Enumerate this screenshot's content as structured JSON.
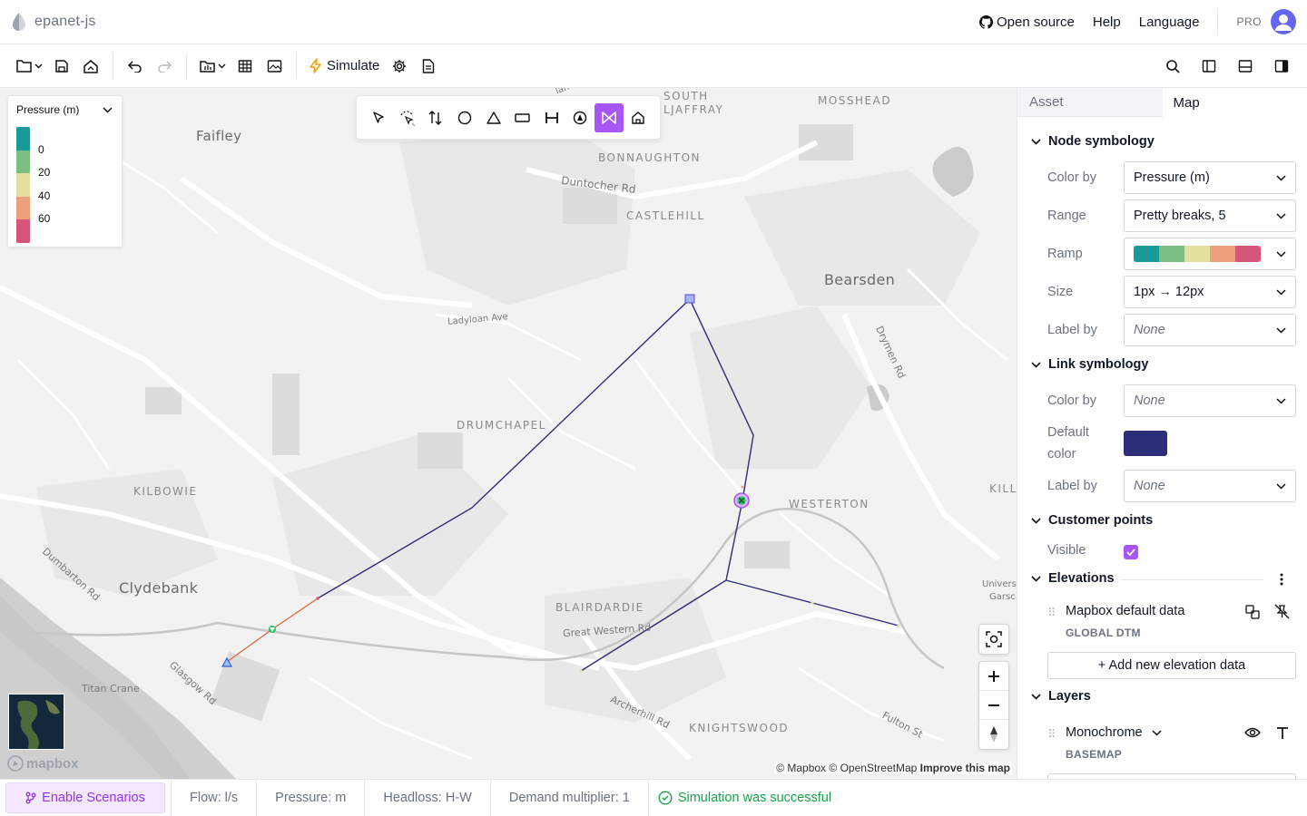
{
  "app": {
    "name": "epanet-js"
  },
  "header": {
    "open_source": "Open source",
    "help": "Help",
    "language": "Language",
    "pro": "PRO"
  },
  "toolbar": {
    "simulate": "Simulate"
  },
  "map": {
    "legend": {
      "title": "Pressure (m)",
      "breaks": [
        "0",
        "20",
        "40",
        "60"
      ],
      "ramp_colors": [
        "#1a9a97",
        "#7bbf82",
        "#e6e0a0",
        "#ec9f7a",
        "#d6557a"
      ]
    },
    "places": {
      "faifley": "Faifley",
      "south_ljaffray_1": "SOUTH",
      "south_ljaffray_2": "LJAFFRAY",
      "mosshead": "MOSSHEAD",
      "bonnaughton": "BONNAUGHTON",
      "duntocher": "Duntocher Rd",
      "castlehill": "CASTLEHILL",
      "bearsden": "Bearsden",
      "ladyloan": "Ladyloan Ave",
      "drymen": "Drymen Rd",
      "drumchapel": "DRUMCHAPEL",
      "kilbowie": "KILBOWIE",
      "westerton": "WESTERTON",
      "killi": "KILLI",
      "dumbarton": "Dumbarton Rd",
      "clydebank": "Clydebank",
      "blairdardie": "BLAIRDARDIE",
      "great_western": "Great Western Rd",
      "univers_1": "Univers",
      "univers_2": "Garsc",
      "glasgow_rd": "Glasgow Rd",
      "titan": "Titan Crane",
      "archerhill": "Archerhill Rd",
      "knightswood": "KNIGHTSWOOD",
      "fulton": "Fulton St",
      "nan_cut": "lan"
    },
    "mapbox_logo": "mapbox",
    "attribution": {
      "mapbox": "© Mapbox",
      "osm": "© OpenStreetMap",
      "improve": "Improve this map"
    },
    "network": {
      "pipe_color": "#2e2d7a",
      "highlight_pipe_color": "#e0643a"
    }
  },
  "panel": {
    "tabs": [
      "Asset",
      "Map"
    ],
    "node_symbology": {
      "title": "Node symbology",
      "color_by_label": "Color by",
      "color_by_value": "Pressure (m)",
      "range_label": "Range",
      "range_value": "Pretty breaks, 5",
      "ramp_label": "Ramp",
      "size_label": "Size",
      "size_value": "1px → 12px",
      "label_by_label": "Label by",
      "label_by_value": "None"
    },
    "link_symbology": {
      "title": "Link symbology",
      "color_by_label": "Color by",
      "color_by_value": "None",
      "default_color_label_1": "Default",
      "default_color_label_2": "color",
      "default_color": "#2e2d7a",
      "label_by_label": "Label by",
      "label_by_value": "None"
    },
    "customer_points": {
      "title": "Customer points",
      "visible_label": "Visible",
      "visible": true
    },
    "elevations": {
      "title": "Elevations",
      "source_title": "Mapbox default data",
      "source_sub": "GLOBAL DTM",
      "add_button": "+ Add new elevation data"
    },
    "layers": {
      "title": "Layers",
      "basemap_name": "Monochrome",
      "basemap_sub": "BASEMAP"
    }
  },
  "footer": {
    "scenarios": "Enable Scenarios",
    "flow": "Flow: l/s",
    "pressure": "Pressure: m",
    "headloss": "Headloss: H-W",
    "demand": "Demand multiplier: 1",
    "status": "Simulation was successful"
  }
}
